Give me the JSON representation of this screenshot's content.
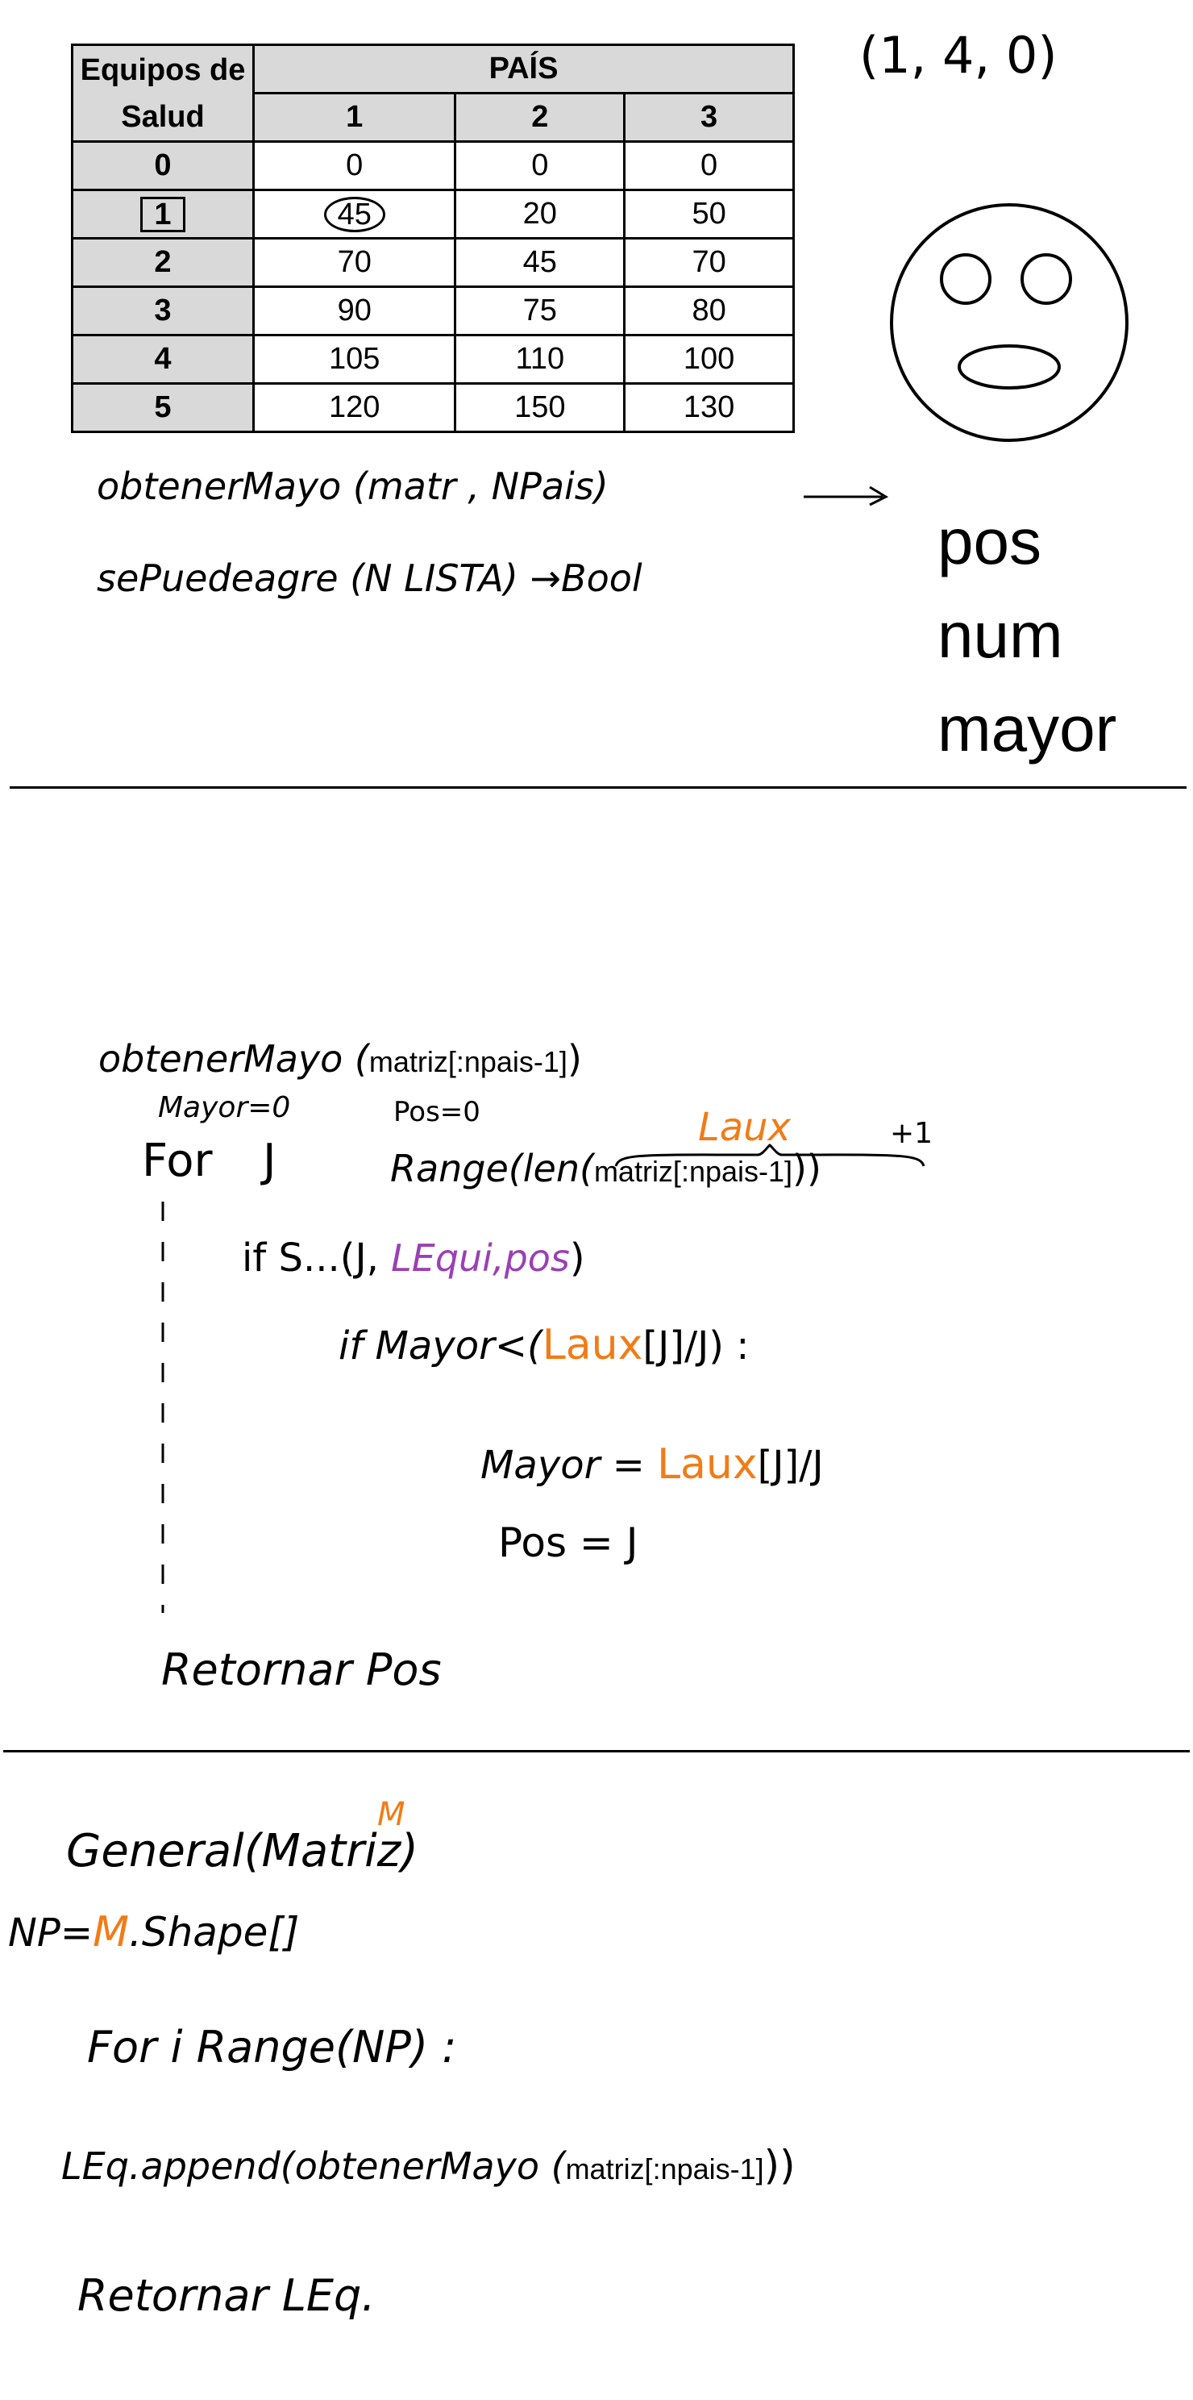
{
  "table": {
    "header_col": "Equipos de Salud",
    "group_header": "PAÍS",
    "countries": [
      "1",
      "2",
      "3"
    ],
    "rows": [
      {
        "team": "0",
        "values": [
          "0",
          "0",
          "0"
        ]
      },
      {
        "team": "1",
        "values": [
          "45",
          "20",
          "50"
        ]
      },
      {
        "team": "2",
        "values": [
          "70",
          "45",
          "70"
        ]
      },
      {
        "team": "3",
        "values": [
          "90",
          "75",
          "80"
        ]
      },
      {
        "team": "4",
        "values": [
          "105",
          "110",
          "100"
        ]
      },
      {
        "team": "5",
        "values": [
          "120",
          "150",
          "130"
        ]
      }
    ]
  },
  "tuple_note": {
    "text": "(1, 4, 0)"
  },
  "right_words": [
    "pos",
    "num",
    "mayor"
  ],
  "section1": {
    "line1": "obtenerMayo (matr , NPais)",
    "line2": "sePuedeagre (N LISTA) →Bool"
  },
  "section2": {
    "header_prefix": "obtenerMayo (",
    "header_arg": "matriz[:npais-1]",
    "header_suffix": ")",
    "mayor_init": "Mayor=0",
    "pos_init": "Pos=0",
    "for_kw": "For",
    "for_var": "J",
    "range_prefix": "Range(len(",
    "range_arg": "matriz[:npais-1]",
    "range_suffix": "))",
    "laux_label": "Laux",
    "plus_one": "+1",
    "if1_prefix": "if S...(J, ",
    "if1_purple": "LEqui,pos",
    "if1_suffix": ")",
    "if2_prefix": "if Mayor<(",
    "if2_orange": "Laux",
    "if2_suffix": "[J]/J) :",
    "assign1_prefix": "Mayor = ",
    "assign1_orange": "Laux",
    "assign1_suffix": "[J]/J",
    "assign2": "Pos = J",
    "return_line": "Retornar Pos"
  },
  "section3": {
    "func_line": "General(Matriz)",
    "m_label": "M",
    "np_prefix": "NP=",
    "np_orange": "M",
    "np_suffix": ".Shape[]",
    "for_line": "For i Range(NP) :",
    "append_prefix": "LEq.append(obtenerMayo (",
    "append_arg": "matriz[:npais-1]",
    "append_suffix": "))",
    "return_line": "Retornar LEq."
  },
  "colors": {
    "orange": "#f07c17",
    "purple": "#9b3fb5",
    "header_gray": "#d9d9d9"
  }
}
